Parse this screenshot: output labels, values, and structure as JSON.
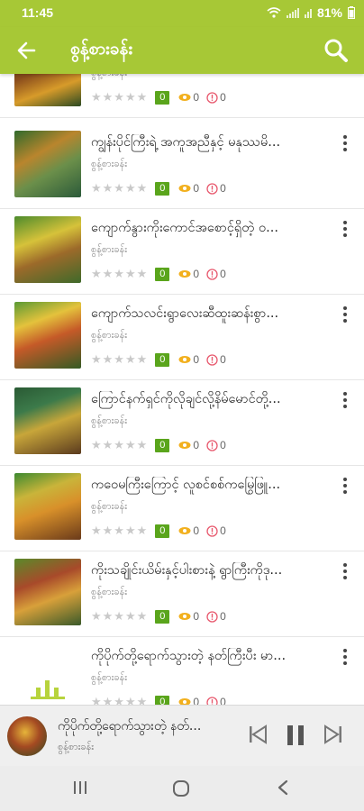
{
  "status_bar": {
    "time": "11:45",
    "battery": "81%"
  },
  "app_bar": {
    "title": "စွန့်စားခန်း"
  },
  "items": [
    {
      "title": "",
      "author": "စွန့်စားခန်း",
      "count": "0",
      "views": "0",
      "info": "0"
    },
    {
      "title": "ကျွန်းပိုင်ကြီးရဲ့ အကူအညီနှင့် မနုဿမိ...",
      "author": "စွန့်စားခန်း",
      "count": "0",
      "views": "0",
      "info": "0"
    },
    {
      "title": "ကျောက်နွားကိုးကောင်အစောင့်ရှိတဲ့ ဝ...",
      "author": "စွန့်စားခန်း",
      "count": "0",
      "views": "0",
      "info": "0"
    },
    {
      "title": "ကျောက်သလင်းရွာလေးဆီထူးဆန်းစွာ...",
      "author": "စွန့်စားခန်း",
      "count": "0",
      "views": "0",
      "info": "0"
    },
    {
      "title": "ကြောင်နက်ရှင်ကိုလိုချင်လို့နိမ်မောင်တို့...",
      "author": "စွန့်စားခန်း",
      "count": "0",
      "views": "0",
      "info": "0"
    },
    {
      "title": "ကဝေမကြီးကြောင့် လူစင်စစ်ကမြွေဖြူ...",
      "author": "စွန့်စားခန်း",
      "count": "0",
      "views": "0",
      "info": "0"
    },
    {
      "title": "ကိုးသချိုင်းယိမ်းနှင့်ပါးစားနဲ့ ရွာကြီးကိုဒု...",
      "author": "စွန့်စားခန်း",
      "count": "0",
      "views": "0",
      "info": "0"
    },
    {
      "title": "ကိုပိုက်တို့ရောက်သွားတဲ့ နတ်ကြီးပီး မာ...",
      "author": "စွန့်စားခန်း",
      "count": "0",
      "views": "0",
      "info": "0"
    }
  ],
  "player": {
    "title": "ကိုပိုက်တို့ရောက်သွားတဲ့ နတ်...",
    "author": "စွန့်စားခန်း"
  },
  "colors": {
    "accent": "#a7c836",
    "count_badge": "#5aa51c",
    "eye": "#f2b01e",
    "info": "#e85a6f"
  }
}
